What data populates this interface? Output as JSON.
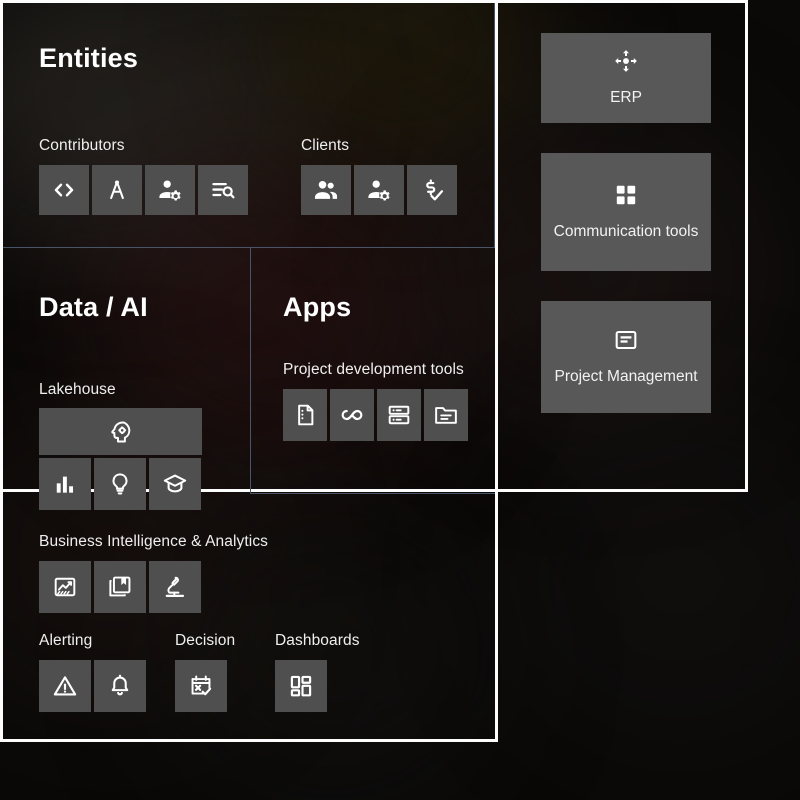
{
  "colors": {
    "panel_border": "#fdfdfd",
    "tile_bg": "#4f4f4f",
    "card_bg": "#585858",
    "divider": "#4a5468",
    "icon": "#ffffff",
    "text": "#ffffff",
    "background": "#0a0908"
  },
  "sections": {
    "entities": {
      "title": "Entities",
      "groups": [
        {
          "label": "Contributors",
          "tiles": [
            {
              "icon": "code-icon"
            },
            {
              "icon": "architecture-compass-icon"
            },
            {
              "icon": "manage-accounts-icon"
            },
            {
              "icon": "list-search-icon"
            }
          ]
        },
        {
          "label": "Clients",
          "tiles": [
            {
              "icon": "group-people-icon"
            },
            {
              "icon": "manage-accounts-icon"
            },
            {
              "icon": "price-check-icon"
            }
          ]
        }
      ]
    },
    "data_ai": {
      "title": "Data / AI",
      "groups": [
        {
          "label": "Lakehouse",
          "tiles": [
            {
              "icon": "psychology-head-gear-icon"
            },
            {
              "icon": "bar-chart-icon"
            },
            {
              "icon": "lightbulb-icon"
            },
            {
              "icon": "graduation-cap-icon"
            }
          ]
        },
        {
          "label": "Business Intelligence & Analytics",
          "tiles": [
            {
              "icon": "monitoring-chart-icon"
            },
            {
              "icon": "collections-bookmark-icon"
            },
            {
              "icon": "microscope-icon"
            }
          ]
        },
        {
          "label": "Alerting",
          "tiles": [
            {
              "icon": "warning-triangle-icon"
            },
            {
              "icon": "notification-bell-icon"
            }
          ]
        },
        {
          "label": "Decision",
          "tiles": [
            {
              "icon": "rule-calendar-icon"
            }
          ]
        },
        {
          "label": "Dashboards",
          "tiles": [
            {
              "icon": "dashboard-grid-icon"
            }
          ]
        }
      ]
    },
    "apps": {
      "title": "Apps",
      "groups": [
        {
          "label": "Project development tools",
          "tiles": [
            {
              "icon": "document-list-icon"
            },
            {
              "icon": "infinity-devops-icon"
            },
            {
              "icon": "server-storage-icon"
            },
            {
              "icon": "folder-open-icon"
            }
          ]
        }
      ]
    }
  },
  "side_cards": [
    {
      "label": "ERP",
      "icon": "open-with-arrows-icon"
    },
    {
      "label": "Communication tools",
      "icon": "apps-grid-icon"
    },
    {
      "label": "Project Management",
      "icon": "text-box-icon"
    }
  ]
}
